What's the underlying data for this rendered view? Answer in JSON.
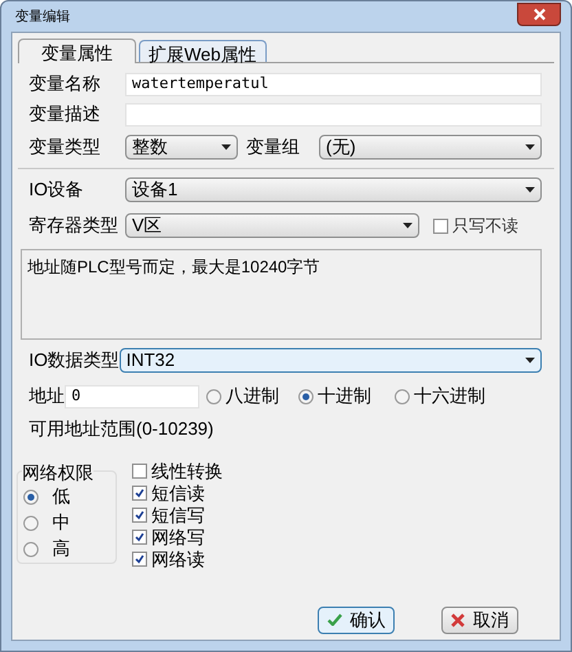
{
  "window": {
    "title": "变量编辑"
  },
  "tabs": [
    {
      "label": "变量属性",
      "selected": true
    },
    {
      "label": "扩展Web属性",
      "selected": false
    }
  ],
  "name_field": {
    "label": "变量名称",
    "value": "watertemperatul"
  },
  "desc_field": {
    "label": "变量描述"
  },
  "var_type": {
    "label": "变量类型",
    "value": "整数"
  },
  "var_group": {
    "label": "变量组",
    "value": "(无)"
  },
  "io_device": {
    "label": "IO设备",
    "value": "设备1"
  },
  "register_type": {
    "label": "寄存器类型",
    "value": "V区"
  },
  "write_only": {
    "label": "只写不读",
    "checked": false
  },
  "info_text": "地址随PLC型号而定，最大是10240字节",
  "io_data_type": {
    "label": "IO数据类型",
    "value": "INT32",
    "focused": true
  },
  "address": {
    "label": "地址",
    "value": "0"
  },
  "radix": [
    {
      "label": "八进制",
      "selected": false
    },
    {
      "label": "十进制",
      "selected": true
    },
    {
      "label": "十六进制",
      "selected": false
    }
  ],
  "address_range": "可用地址范围(0-10239)",
  "network_permission": {
    "title": "网络权限",
    "options": [
      {
        "label": "低",
        "selected": true
      },
      {
        "label": "中",
        "selected": false
      },
      {
        "label": "高",
        "selected": false
      }
    ]
  },
  "options": [
    {
      "label": "线性转换",
      "checked": false
    },
    {
      "label": "短信读",
      "checked": true
    },
    {
      "label": "短信写",
      "checked": true
    },
    {
      "label": "网络写",
      "checked": true
    },
    {
      "label": "网络读",
      "checked": true
    }
  ],
  "buttons": [
    {
      "kind": "ok",
      "label": "确认"
    },
    {
      "kind": "cancel",
      "label": "取消"
    }
  ]
}
